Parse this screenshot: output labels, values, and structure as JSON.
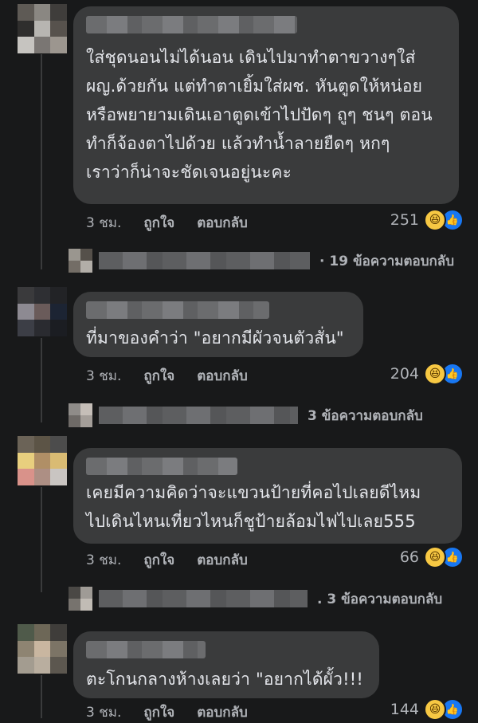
{
  "comments": [
    {
      "text": "ใส่ชุดนอนไม่ได้นอน เดินไปมาทำตาขวางๆใส่\nผญ.ด้วยกัน แต่ทำตาเยิ้มใส่ผช. หันตูดให้หน่อย\nหรือพยายามเดินเอาตูดเข้าไปปัดๆ ถูๆ ชนๆ ตอน\nทำก็จ้องตาไปด้วย แล้วทำน้ำลายยืดๆ หกๆ\nเราว่าก็น่าจะชัดเจนอยู่นะคะ",
      "time": "3 ชม.",
      "like": "ถูกใจ",
      "reply": "ตอบกลับ",
      "reactions": "251",
      "replies": "· 19 ข้อความตอบกลับ"
    },
    {
      "text": "ที่มาของคำว่า \"อยากมีผัวจนตัวสั่น\"",
      "time": "3 ชม.",
      "like": "ถูกใจ",
      "reply": "ตอบกลับ",
      "reactions": "204",
      "replies": "3 ข้อความตอบกลับ"
    },
    {
      "text": "เคยมีความคิดว่าจะแขวนป้ายที่คอไปเลยดีไหม\nไปเดินไหนเที่ยวไหนก็ชูป้ายล้อมไฟไปเลย555",
      "time": "3 ชม.",
      "like": "ถูกใจ",
      "reply": "ตอบกลับ",
      "reactions": "66",
      "replies": ". 3 ข้อความตอบกลับ"
    },
    {
      "text": "ตะโกนกลางห้างเลยว่า \"อยากได้ผั้ว!!!",
      "time": "3 ชม.",
      "like": "ถูกใจ",
      "reply": "ตอบกลับ",
      "reactions": "144"
    }
  ],
  "icons": {
    "haha": "haha-emoji-icon",
    "like": "thumbs-up-icon"
  },
  "colors": {
    "background": "#18191a",
    "bubble": "#3a3b3c",
    "text": "#e4e6eb",
    "meta": "#b0b3b8",
    "like_blue": "#1877f2",
    "haha_yellow": "#f7c843"
  }
}
